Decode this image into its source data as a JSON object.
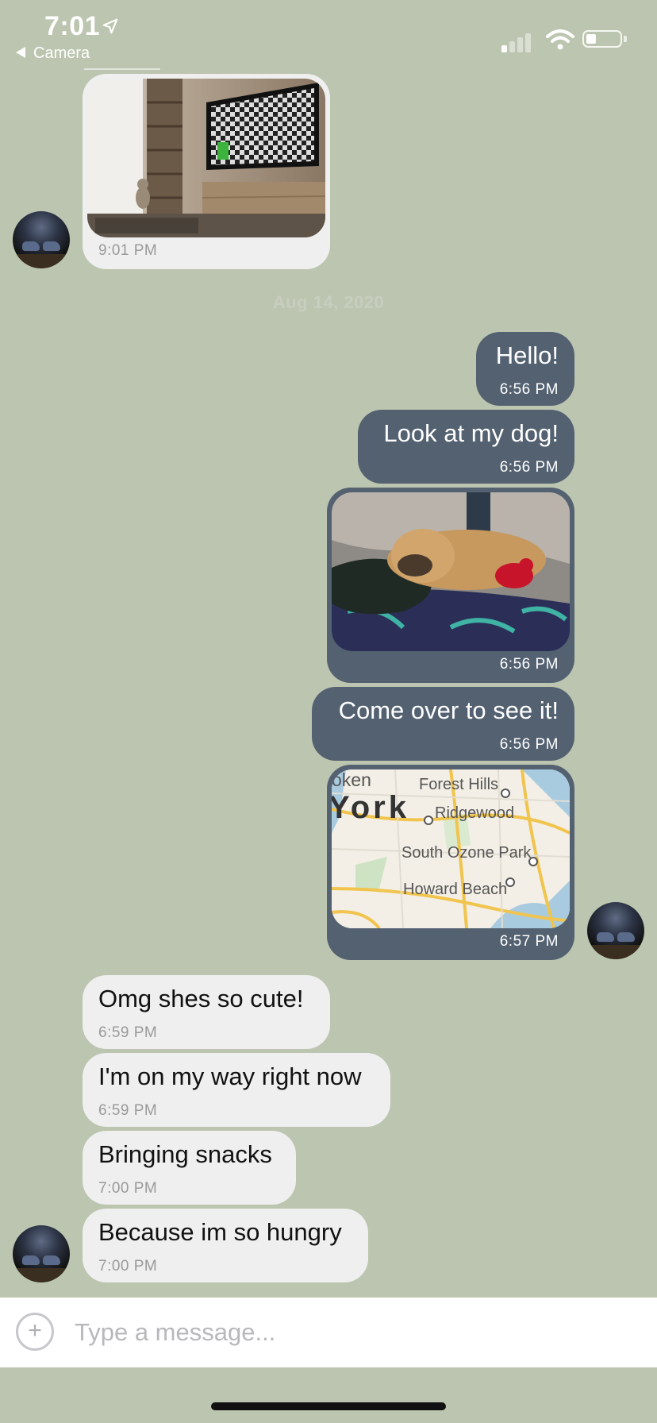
{
  "status_bar": {
    "time": "7:01",
    "back_label": "Camera",
    "signal_bars": 1,
    "battery_level": 0.2
  },
  "date_separator": "Aug 14, 2020",
  "messages": [
    {
      "side": "in",
      "type": "image",
      "image": "living room with TV and cat",
      "time": "9:01 PM"
    },
    {
      "side": "out",
      "type": "text",
      "text": "Hello!",
      "time": "6:56 PM"
    },
    {
      "side": "out",
      "type": "text",
      "text": "Look at my dog!",
      "time": "6:56 PM"
    },
    {
      "side": "out",
      "type": "image",
      "image": "bulldog sleeping on blanket",
      "time": "6:56 PM"
    },
    {
      "side": "out",
      "type": "text",
      "text": "Come over to see it!",
      "time": "6:56 PM"
    },
    {
      "side": "out",
      "type": "location",
      "map_labels": [
        "oken",
        "York",
        "Forest Hills",
        "Ridgewood",
        "South Ozone Park",
        "Howard Beach"
      ],
      "time": "6:57 PM"
    },
    {
      "side": "in",
      "type": "text",
      "text": "Omg shes so cute!",
      "time": "6:59 PM"
    },
    {
      "side": "in",
      "type": "text",
      "text": "I'm on my way right now",
      "time": "6:59 PM"
    },
    {
      "side": "in",
      "type": "text",
      "text": "Bringing snacks",
      "time": "7:00 PM"
    },
    {
      "side": "in",
      "type": "text",
      "text": "Because im so hungry",
      "time": "7:00 PM"
    }
  ],
  "composer": {
    "placeholder": "Type a message...",
    "value": ""
  },
  "colors": {
    "background": "#BCC5AF",
    "outgoing_bubble": "#536171",
    "incoming_bubble": "#EFEFF0"
  }
}
